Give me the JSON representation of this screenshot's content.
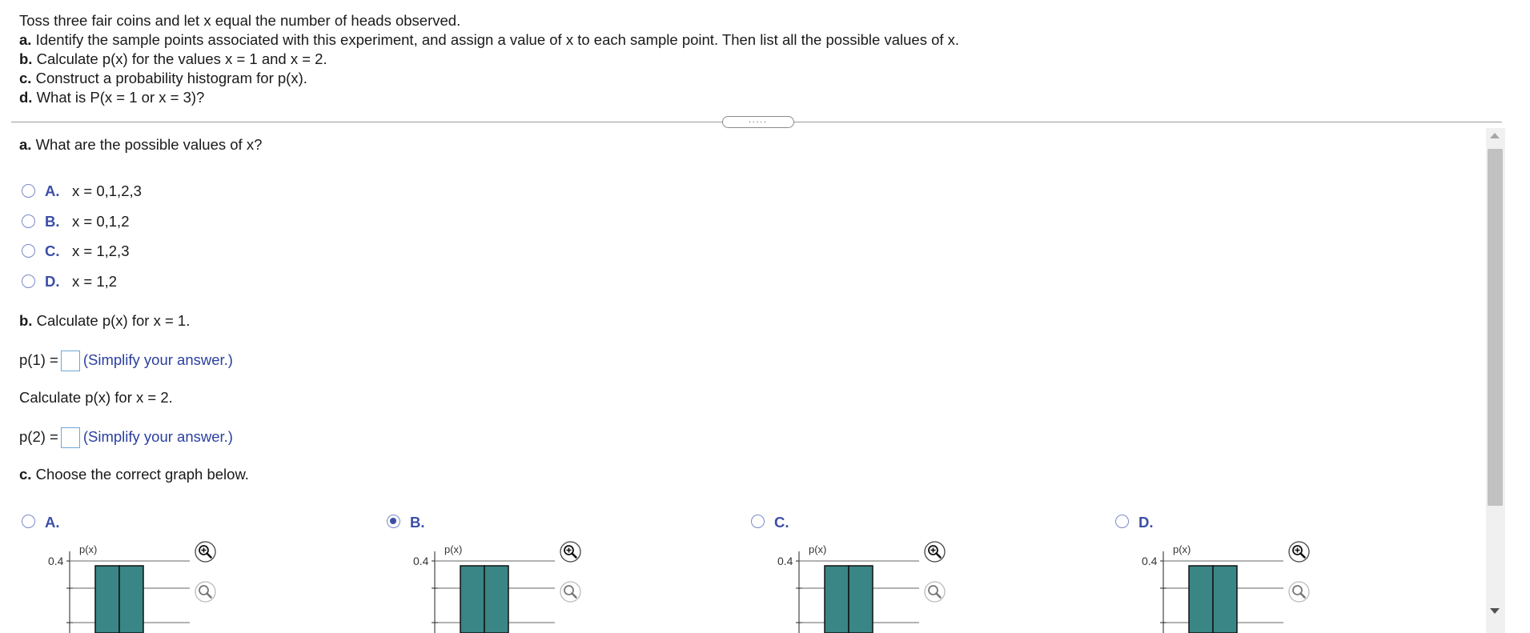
{
  "question": {
    "intro": "Toss three fair coins and let x equal the number of heads observed.",
    "parts": [
      {
        "letter": "a.",
        "text": " Identify the sample points associated with this experiment, and assign a value of x to each sample point. Then list all the possible values of x."
      },
      {
        "letter": "b.",
        "text": " Calculate p(x) for the values x = 1 and x = 2."
      },
      {
        "letter": "c.",
        "text": " Construct a probability histogram for p(x)."
      },
      {
        "letter": "d.",
        "text": " What is P(x = 1 or x = 3)?"
      }
    ]
  },
  "divider_handle": ".....",
  "part_a": {
    "letter": "a.",
    "prompt": " What are the possible values of x?",
    "options": [
      {
        "letter": "A.",
        "text": "x = 0,1,2,3"
      },
      {
        "letter": "B.",
        "text": "x = 0,1,2"
      },
      {
        "letter": "C.",
        "text": "x = 1,2,3"
      },
      {
        "letter": "D.",
        "text": "x = 1,2"
      }
    ]
  },
  "part_b": {
    "letter": "b.",
    "prompt": " Calculate p(x) for x = 1.",
    "p1_label": "p(1) =",
    "p1_value": "",
    "hint": "(Simplify your answer.)",
    "prompt2": "Calculate p(x) for x = 2.",
    "p2_label": "p(2) =",
    "p2_value": ""
  },
  "part_c": {
    "letter": "c.",
    "prompt": " Choose the correct graph below.",
    "selected": "B.",
    "options": [
      {
        "letter": "A.",
        "y_label": "p(x)",
        "tick": "0.4"
      },
      {
        "letter": "B.",
        "y_label": "p(x)",
        "tick": "0.4"
      },
      {
        "letter": "C.",
        "y_label": "p(x)",
        "tick": "0.4"
      },
      {
        "letter": "D.",
        "y_label": "p(x)",
        "tick": "0.4"
      }
    ]
  },
  "colors": {
    "accent": "#3b4ea8",
    "hint": "#2a3fa0",
    "bar_fill": "#3a8585",
    "input_border": "#6da7d9"
  },
  "icons": {
    "zoom_in": "zoom-in-icon",
    "zoom_out": "zoom-out-icon"
  }
}
